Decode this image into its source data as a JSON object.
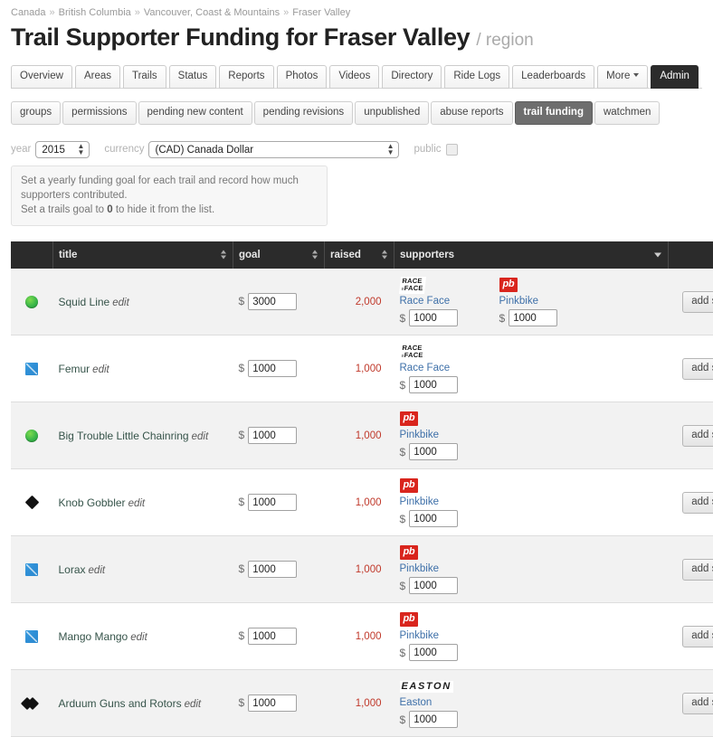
{
  "breadcrumb": {
    "separator": "»",
    "items": [
      "Canada",
      "British Columbia",
      "Vancouver, Coast & Mountains",
      "Fraser Valley"
    ]
  },
  "header": {
    "title": "Trail Supporter Funding for Fraser Valley",
    "subtype": "/ region"
  },
  "tabs": [
    {
      "label": "Overview",
      "active": false
    },
    {
      "label": "Areas",
      "active": false
    },
    {
      "label": "Trails",
      "active": false
    },
    {
      "label": "Status",
      "active": false
    },
    {
      "label": "Reports",
      "active": false
    },
    {
      "label": "Photos",
      "active": false
    },
    {
      "label": "Videos",
      "active": false
    },
    {
      "label": "Directory",
      "active": false
    },
    {
      "label": "Ride Logs",
      "active": false
    },
    {
      "label": "Leaderboards",
      "active": false
    },
    {
      "label": "More",
      "active": false,
      "caret": true
    },
    {
      "label": "Admin",
      "active": true
    }
  ],
  "subtabs": [
    {
      "label": "groups",
      "active": false
    },
    {
      "label": "permissions",
      "active": false
    },
    {
      "label": "pending new content",
      "active": false
    },
    {
      "label": "pending revisions",
      "active": false
    },
    {
      "label": "unpublished",
      "active": false
    },
    {
      "label": "abuse reports",
      "active": false
    },
    {
      "label": "trail funding",
      "active": true
    },
    {
      "label": "watchmen",
      "active": false
    }
  ],
  "filters": {
    "year_label": "year",
    "year_value": "2015",
    "currency_label": "currency",
    "currency_value": "(CAD) Canada Dollar",
    "public_label": "public",
    "public_checked": false
  },
  "info": {
    "line1_a": "Set a yearly funding goal for each trail and record how much supporters contributed.",
    "line2_a": "Set a trails goal to ",
    "line2_b": "0",
    "line2_c": " to hide it from the list."
  },
  "table": {
    "columns": [
      {
        "key": "icon",
        "label": "",
        "sort": false
      },
      {
        "key": "title",
        "label": "title",
        "sort": true
      },
      {
        "key": "goal",
        "label": "goal",
        "sort": true
      },
      {
        "key": "raised",
        "label": "raised",
        "sort": true
      },
      {
        "key": "supporters",
        "label": "supporters",
        "sort": false,
        "caret": true
      },
      {
        "key": "actions",
        "label": "",
        "sort": false
      }
    ],
    "currency_symbol": "$",
    "edit_label": "edit",
    "add_supporter_label": "add supporter",
    "rows": [
      {
        "difficulty": "green",
        "title": "Squid Line",
        "goal": "3000",
        "raised": "2,000",
        "supporters": [
          {
            "logo": "raceface",
            "name": "Race Face",
            "amount": "1000"
          },
          {
            "logo": "pinkbike",
            "name": "Pinkbike",
            "amount": "1000"
          }
        ]
      },
      {
        "difficulty": "blue",
        "title": "Femur",
        "goal": "1000",
        "raised": "1,000",
        "supporters": [
          {
            "logo": "raceface",
            "name": "Race Face",
            "amount": "1000"
          }
        ]
      },
      {
        "difficulty": "green",
        "title": "Big Trouble Little Chainring",
        "goal": "1000",
        "raised": "1,000",
        "supporters": [
          {
            "logo": "pinkbike",
            "name": "Pinkbike",
            "amount": "1000"
          }
        ]
      },
      {
        "difficulty": "black",
        "title": "Knob Gobbler",
        "goal": "1000",
        "raised": "1,000",
        "supporters": [
          {
            "logo": "pinkbike",
            "name": "Pinkbike",
            "amount": "1000"
          }
        ]
      },
      {
        "difficulty": "blue",
        "title": "Lorax",
        "goal": "1000",
        "raised": "1,000",
        "supporters": [
          {
            "logo": "pinkbike",
            "name": "Pinkbike",
            "amount": "1000"
          }
        ]
      },
      {
        "difficulty": "blue",
        "title": "Mango Mango",
        "goal": "1000",
        "raised": "1,000",
        "supporters": [
          {
            "logo": "pinkbike",
            "name": "Pinkbike",
            "amount": "1000"
          }
        ]
      },
      {
        "difficulty": "double-black",
        "title": "Arduum Guns and Rotors",
        "goal": "1000",
        "raised": "1,000",
        "supporters": [
          {
            "logo": "easton",
            "name": "Easton",
            "amount": "1000"
          }
        ]
      }
    ]
  },
  "logos": {
    "raceface_line1": "RACE",
    "raceface_line2": "FACE",
    "raceface_prefix": "≡",
    "pinkbike": "pb",
    "easton": "EASTON"
  },
  "colors": {
    "accent_red": "#c0392b",
    "link_blue": "#3d6fa8",
    "header_dark": "#2b2b2b",
    "pinkbike_red": "#d9251d"
  }
}
